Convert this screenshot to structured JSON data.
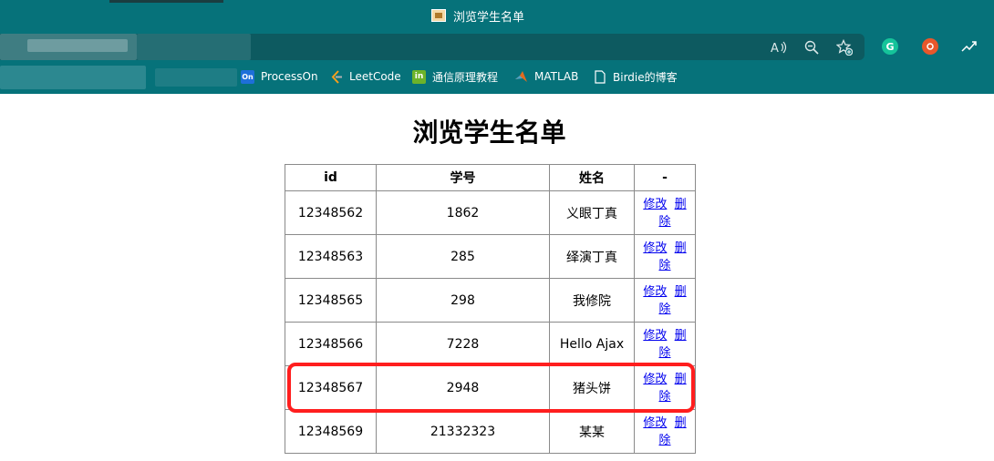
{
  "window": {
    "title": "浏览学生名单",
    "favicon": "page-favicon-icon"
  },
  "toolbar": {
    "icons": [
      "read-aloud-icon",
      "zoom-out-icon",
      "add-favorite-icon"
    ],
    "extensions": [
      "grammarly-icon",
      "extension-orange-icon",
      "extension-chart-icon"
    ]
  },
  "bookmarks": [
    {
      "label": "ProcessOn",
      "icon": "processon-icon",
      "icon_text": "On",
      "color": "#1e6fd9"
    },
    {
      "label": "LeetCode",
      "icon": "leetcode-icon",
      "icon_text": "",
      "color": "#f89f1b"
    },
    {
      "label": "通信原理教程",
      "icon": "book-icon",
      "icon_text": "in",
      "color": "#6cb32a"
    },
    {
      "label": "MATLAB",
      "icon": "matlab-icon",
      "icon_text": "",
      "color": "#e36b1e"
    },
    {
      "label": "Birdie的博客",
      "icon": "page-icon",
      "icon_text": "",
      "color": "#ffffff"
    }
  ],
  "page": {
    "heading": "浏览学生名单",
    "table": {
      "headers": [
        "id",
        "学号",
        "姓名",
        "-"
      ],
      "edit_label": "修改",
      "delete_label_1": "删",
      "delete_label_2": "除",
      "rows": [
        {
          "id": "12348562",
          "number": "1862",
          "name": "义眼丁真"
        },
        {
          "id": "12348563",
          "number": "285",
          "name": "绎演丁真"
        },
        {
          "id": "12348565",
          "number": "298",
          "name": "我修院"
        },
        {
          "id": "12348566",
          "number": "7228",
          "name": "Hello Ajax"
        },
        {
          "id": "12348567",
          "number": "2948",
          "name": "猪头饼"
        },
        {
          "id": "12348569",
          "number": "21332323",
          "name": "某某"
        }
      ]
    }
  },
  "colors": {
    "chrome": "#06727a",
    "highlight": "#ff1e1e",
    "link": "#0000ee"
  }
}
